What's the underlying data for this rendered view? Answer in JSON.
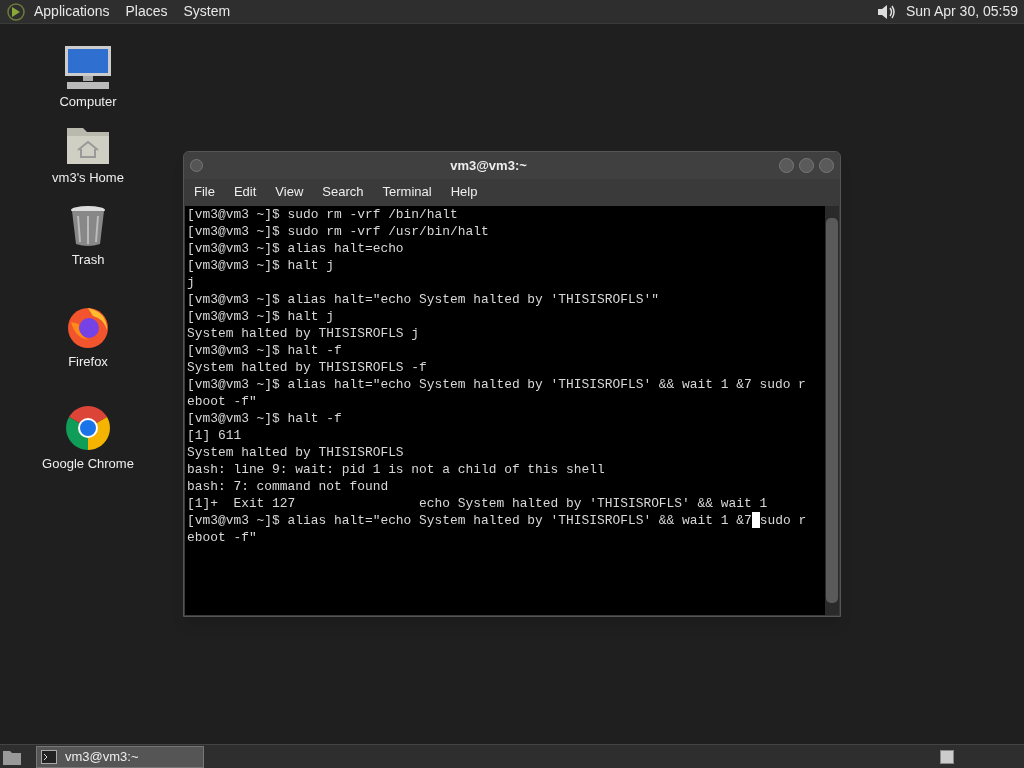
{
  "top_panel": {
    "menus": [
      "Applications",
      "Places",
      "System"
    ],
    "clock": "Sun Apr 30, 05:59"
  },
  "desktop_icons": [
    {
      "kind": "computer",
      "label": "Computer"
    },
    {
      "kind": "home",
      "label": "vm3's Home"
    },
    {
      "kind": "trash",
      "label": "Trash"
    },
    {
      "kind": "firefox",
      "label": "Firefox"
    },
    {
      "kind": "chrome",
      "label": "Google Chrome"
    }
  ],
  "window": {
    "title": "vm3@vm3:~",
    "menu": [
      "File",
      "Edit",
      "View",
      "Search",
      "Terminal",
      "Help"
    ],
    "lines": [
      {
        "text": "[vm3@vm3 ~]$ sudo rm -vrf /bin/halt"
      },
      {
        "text": "[vm3@vm3 ~]$ sudo rm -vrf /usr/bin/halt"
      },
      {
        "text": "[vm3@vm3 ~]$ alias halt=echo"
      },
      {
        "text": "[vm3@vm3 ~]$ halt j"
      },
      {
        "text": "j"
      },
      {
        "text": "[vm3@vm3 ~]$ alias halt=\"echo System halted by 'THISISROFLS'\""
      },
      {
        "text": "[vm3@vm3 ~]$ halt j"
      },
      {
        "text": "System halted by THISISROFLS j"
      },
      {
        "text": "[vm3@vm3 ~]$ halt -f"
      },
      {
        "text": "System halted by THISISROFLS -f"
      },
      {
        "text": "[vm3@vm3 ~]$ alias halt=\"echo System halted by 'THISISROFLS' && wait 1 &7 sudo r"
      },
      {
        "text": "eboot -f\""
      },
      {
        "text": "[vm3@vm3 ~]$ halt -f"
      },
      {
        "text": "[1] 611"
      },
      {
        "text": "System halted by THISISROFLS"
      },
      {
        "text": "bash: line 9: wait: pid 1 is not a child of this shell"
      },
      {
        "text": "bash: 7: command not found"
      },
      {
        "text": "[1]+  Exit 127                echo System halted by 'THISISROFLS' && wait 1"
      },
      {
        "text": "[vm3@vm3 ~]$ alias halt=\"echo System halted by 'THISISROFLS' && wait 1 &7",
        "cursor": true,
        "after": "sudo r"
      },
      {
        "text": "eboot -f\""
      }
    ]
  },
  "taskbar": {
    "tasks": [
      {
        "label": "vm3@vm3:~",
        "selected": true
      }
    ]
  }
}
